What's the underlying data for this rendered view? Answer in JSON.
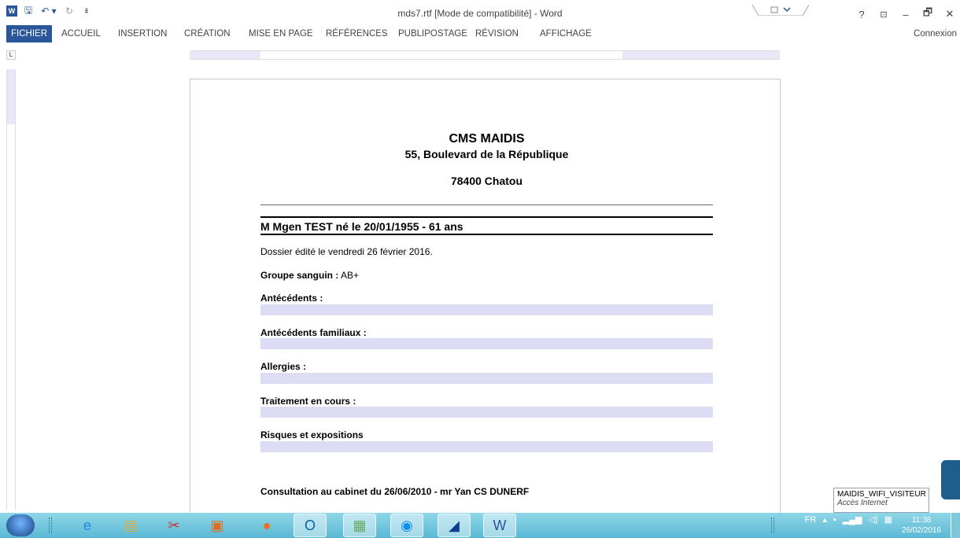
{
  "window": {
    "title": "mds7.rtf [Mode de compatibilité] - Word",
    "help": "?",
    "minimize": "–",
    "maximize": "🗗",
    "close": "✕"
  },
  "qat": {
    "app_icon": "W",
    "save": "🖫",
    "undo": "↶ ▾",
    "redo": "↻",
    "customize": "⇟"
  },
  "tabs": [
    {
      "label": "FICHIER"
    },
    {
      "label": "ACCUEIL"
    },
    {
      "label": "INSERTION"
    },
    {
      "label": "CRÉATION"
    },
    {
      "label": "MISE EN PAGE"
    },
    {
      "label": "RÉFÉRENCES"
    },
    {
      "label": "PUBLIPOSTAGE"
    },
    {
      "label": "RÉVISION"
    },
    {
      "label": "AFFICHAGE"
    }
  ],
  "signin": "Connexion",
  "ruler_corner": "L",
  "document": {
    "org": "CMS MAIDIS",
    "address": "55, Boulevard de la République",
    "city": "78400 Chatou",
    "patient": "M Mgen TEST né le 20/01/1955 - 61 ans",
    "edited": "Dossier édité le vendredi 26 février 2016.",
    "blood_label": "Groupe sanguin :",
    "blood_value": " AB+",
    "antecedents": "Antécédents :",
    "family": "Antécédents familiaux :",
    "allergies": "Allergies :",
    "treatment": "Traitement en cours :",
    "risks": "Risques et expositions",
    "consultation": "Consultation au cabinet du 26/06/2010  - mr Yan CS DUNERF"
  },
  "tooltip": {
    "network": "MAIDIS_WIFI_VISITEUR",
    "status": "Accès Internet"
  },
  "tray": {
    "lang": "FR",
    "time": "11:38",
    "date": "26/02/2016"
  },
  "colors": {
    "accent": "#2b579a",
    "shade": "#dcdcf5",
    "taskbar": "#5ab8d4"
  }
}
